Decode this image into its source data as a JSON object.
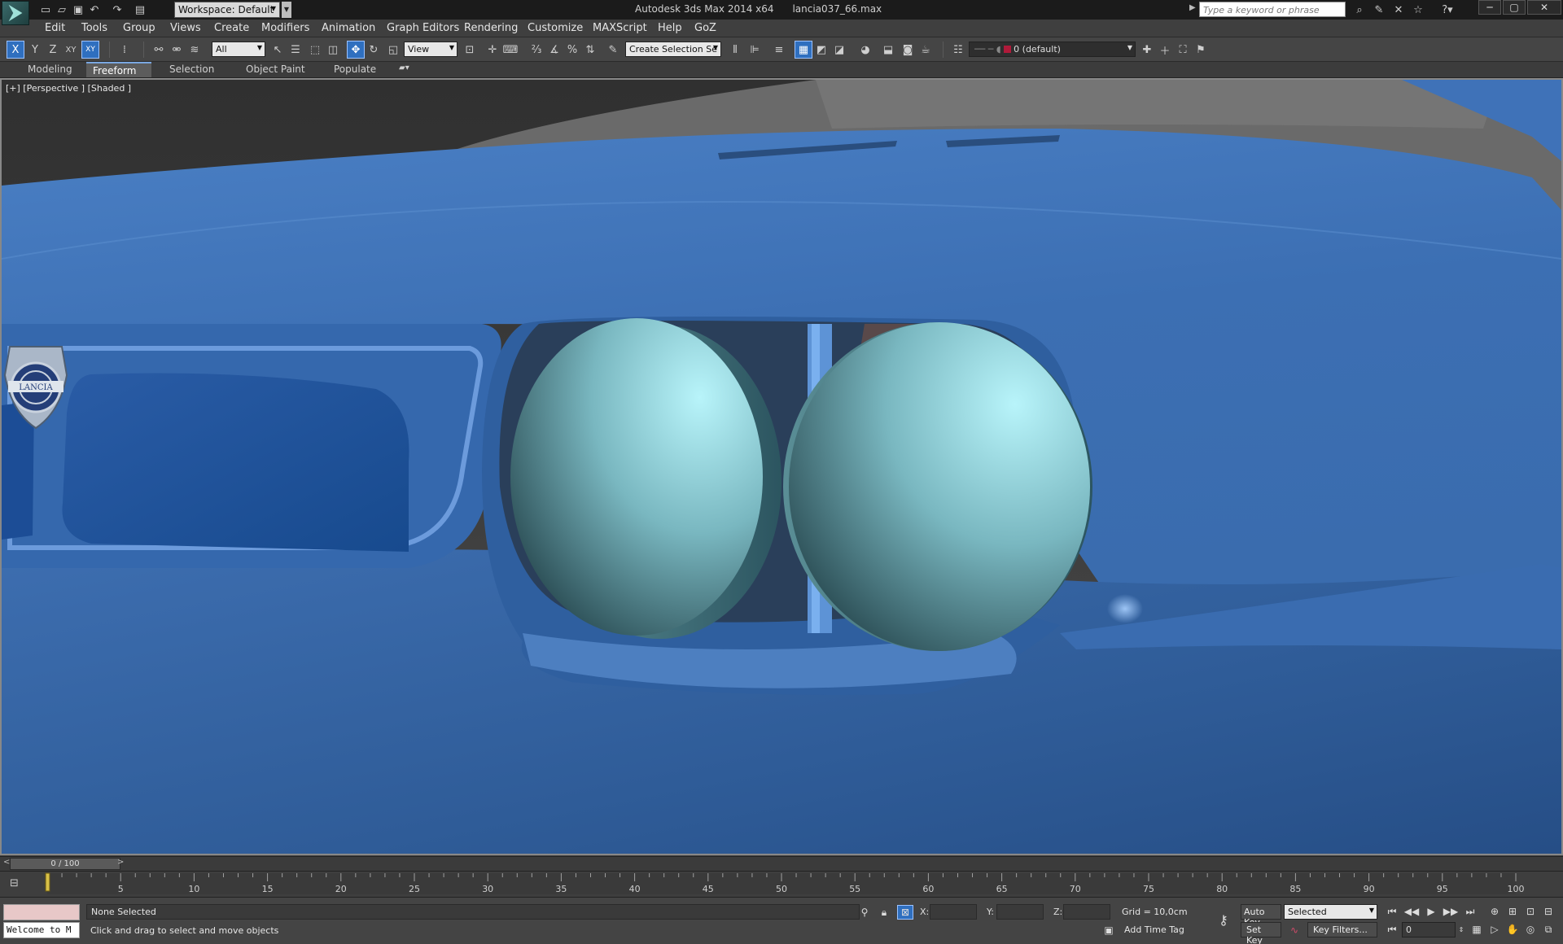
{
  "window": {
    "app_title": "Autodesk 3ds Max 2014 x64",
    "file_name": "lancia037_66.max",
    "workspace": "Workspace: Default",
    "search_placeholder": "Type a keyword or phrase"
  },
  "menu": [
    "Edit",
    "Tools",
    "Group",
    "Views",
    "Create",
    "Modifiers",
    "Animation",
    "Graph Editors",
    "Rendering",
    "Customize",
    "MAXScript",
    "Help",
    "GoZ"
  ],
  "toolbar": {
    "axis_x": "X",
    "axis_y": "Y",
    "axis_z": "Z",
    "axis_xy": "XY",
    "selection_filter": "All",
    "ref_coord": "View",
    "named_selection": "Create Selection Se",
    "layer": "0 (default)"
  },
  "ribbon_tabs": [
    "Modeling",
    "Freeform",
    "Selection",
    "Object Paint",
    "Populate"
  ],
  "ribbon_active_index": 1,
  "viewport": {
    "label": "[+] [Perspective ] [Shaded ]",
    "badge_text": "LANCIA"
  },
  "timeline": {
    "frame_display": "0 / 100",
    "prev": "<",
    "next": ">",
    "ticks": [
      "5",
      "10",
      "15",
      "20",
      "25",
      "30",
      "35",
      "40",
      "45",
      "50",
      "55",
      "60",
      "65",
      "70",
      "75",
      "80",
      "85",
      "90",
      "95",
      "100"
    ]
  },
  "status": {
    "selection": "None Selected",
    "prompt": "Click and drag to select and move objects",
    "listener": "Welcome to M",
    "x_label": "X:",
    "y_label": "Y:",
    "z_label": "Z:",
    "grid": "Grid = 10,0cm",
    "add_time_tag": "Add Time Tag",
    "auto_key": "Auto Key",
    "set_key": "Set Key",
    "key_mode": "Selected",
    "key_filters": "Key Filters...",
    "current_frame": "0"
  },
  "colors": {
    "body_blue": "#3f72b8",
    "lamp_cyan": "#8fd2d8",
    "active_blue": "#2f6fbf"
  }
}
